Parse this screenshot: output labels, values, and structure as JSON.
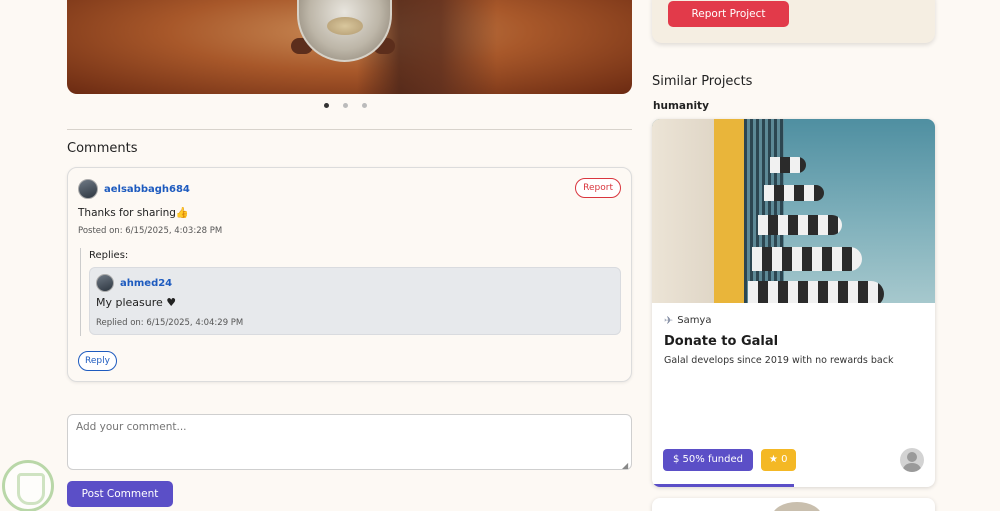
{
  "carousel": {
    "active_index": 0,
    "count": 3
  },
  "comments": {
    "title": "Comments",
    "items": [
      {
        "username": "aelsabbagh684",
        "report_label": "Report",
        "text": "Thanks for sharing👍",
        "posted": "Posted on: 6/15/2025, 4:03:28 PM",
        "replies_label": "Replies:",
        "replies": [
          {
            "username": "ahmed24",
            "text": "My pleasure ♥",
            "date": "Replied on: 6/15/2025, 4:04:29 PM"
          }
        ],
        "reply_label": "Reply"
      }
    ],
    "input_placeholder": "Add your comment...",
    "post_label": "Post Comment"
  },
  "sidebar": {
    "report_project_label": "Report Project",
    "similar_title": "Similar Projects",
    "category": "humanity",
    "project": {
      "owner": "Samya",
      "title": "Donate to Galal",
      "description": "Galal develops since 2019 with no rewards back",
      "funded_label": "$ 50% funded",
      "funded_fraction": 0.5,
      "stars": "0"
    }
  },
  "colors": {
    "primary": "#5b4fc7",
    "danger": "#e23a4a",
    "link": "#1e5bbf",
    "star": "#f4b825"
  }
}
